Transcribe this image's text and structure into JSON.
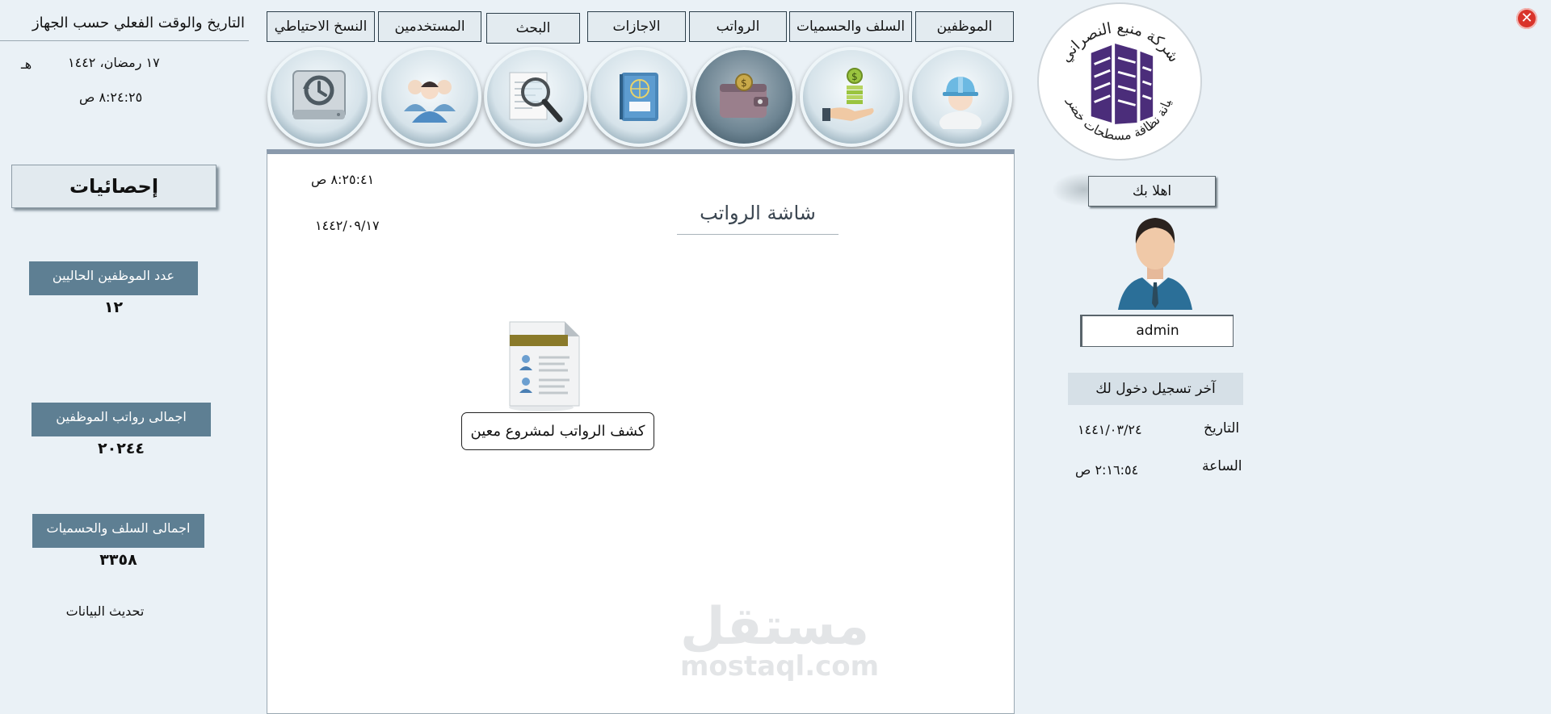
{
  "window": {
    "close_glyph": "✕"
  },
  "tabs": [
    {
      "label": "الموظفين"
    },
    {
      "label": "السلف والحسميات"
    },
    {
      "label": "الرواتب"
    },
    {
      "label": "الاجازات"
    },
    {
      "label": "البحث"
    },
    {
      "label": "المستخدمين"
    },
    {
      "label": "النسخ الاحتياطي"
    }
  ],
  "icons": [
    "worker-helmet-icon",
    "money-hand-icon",
    "wallet-icon",
    "passport-icon",
    "magnifier-document-icon",
    "users-group-icon",
    "backup-drive-icon"
  ],
  "left_panel": {
    "heading": "التاريخ والوقت الفعلي حسب الجهاز",
    "hijri_date": "١٧ رمضان، ١٤٤٢",
    "hijri_suffix": "هـ",
    "time": "٨:٢٤:٢٥ ص",
    "stats_title": "إحصائيات",
    "stats": [
      {
        "label": "عدد الموظفين الحاليين",
        "value": "١٢"
      },
      {
        "label": "اجمالى رواتب الموظفين",
        "value": "٢٠٢٤٤"
      },
      {
        "label": "اجمالى السلف والحسميات",
        "value": "٣٣٥٨"
      }
    ],
    "refresh_label": "تحديث البيانات"
  },
  "main": {
    "screen_title": "شاشة الرواتب",
    "time": "٨:٢٥:٤١ ص",
    "date": "١٤٤٢/٠٩/١٧",
    "report_button": "كشف الرواتب لمشروع معين",
    "watermark_arabic": "مستقل",
    "watermark_latin": "mostaql.com"
  },
  "right_panel": {
    "logo_text_top": "شركة منبع النصراني",
    "logo_text_bottom": "صيانة نظافة مسطحات خضراء",
    "welcome": "اهلا بك",
    "username": "admin",
    "last_login_title": "آخر تسجيل دخول لك",
    "date_label": "التاريخ",
    "date_value": "١٤٤١/٠٣/٢٤",
    "time_label": "الساعة",
    "time_value": "٢:١٦:٥٤ ص"
  },
  "colors": {
    "background": "#eaf1f6",
    "label_blue": "#5e7f93",
    "close_red": "#d9342b",
    "logo_purple": "#4b2d7a"
  }
}
